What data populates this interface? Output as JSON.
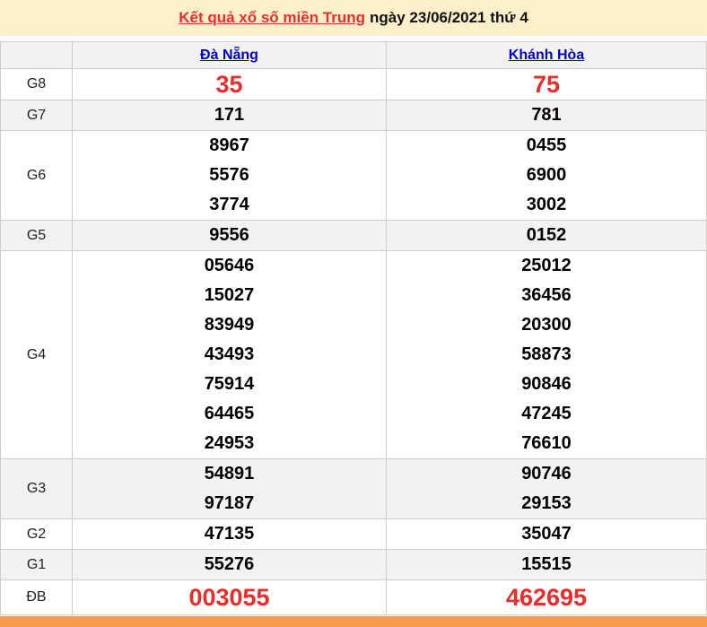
{
  "title": {
    "link_text": "Kết quả xổ số miền Trung",
    "suffix": "ngày 23/06/2021 thứ 4"
  },
  "table": {
    "corner": "",
    "columns": [
      "Đà Nẵng",
      "Khánh Hòa"
    ],
    "rows": [
      {
        "label": "G8",
        "danang": [
          "35"
        ],
        "khanhhoa": [
          "75"
        ],
        "highlight": true
      },
      {
        "label": "G7",
        "danang": [
          "171"
        ],
        "khanhhoa": [
          "781"
        ],
        "highlight": false
      },
      {
        "label": "G6",
        "danang": [
          "8967",
          "5576",
          "3774"
        ],
        "khanhhoa": [
          "0455",
          "6900",
          "3002"
        ],
        "highlight": false
      },
      {
        "label": "G5",
        "danang": [
          "9556"
        ],
        "khanhhoa": [
          "0152"
        ],
        "highlight": false
      },
      {
        "label": "G4",
        "danang": [
          "05646",
          "15027",
          "83949",
          "43493",
          "75914",
          "64465",
          "24953"
        ],
        "khanhhoa": [
          "25012",
          "36456",
          "20300",
          "58873",
          "90846",
          "47245",
          "76610"
        ],
        "highlight": false
      },
      {
        "label": "G3",
        "danang": [
          "54891",
          "97187"
        ],
        "khanhhoa": [
          "90746",
          "29153"
        ],
        "highlight": false
      },
      {
        "label": "G2",
        "danang": [
          "47135"
        ],
        "khanhhoa": [
          "35047"
        ],
        "highlight": false
      },
      {
        "label": "G1",
        "danang": [
          "55276"
        ],
        "khanhhoa": [
          "15515"
        ],
        "highlight": false
      },
      {
        "label": "ĐB",
        "danang": [
          "003055"
        ],
        "khanhhoa": [
          "462695"
        ],
        "highlight": true
      }
    ]
  },
  "colors": {
    "title_background": "#fbf0ca",
    "accent_red": "#e92c2c",
    "link_blue": "#0000cc",
    "row_alternate": "#f2f2f2",
    "table_border": "#d4ccc4",
    "footer_orange": "#f89c4c"
  }
}
